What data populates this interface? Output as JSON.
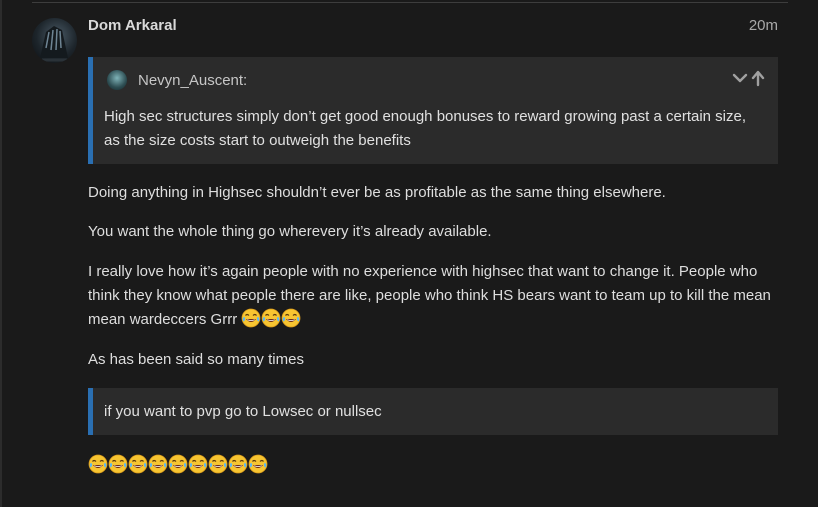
{
  "post": {
    "author": "Dom Arkaral",
    "time": "20m",
    "quote": {
      "user": "Nevyn_Auscent:",
      "text": "High sec structures simply don’t get good enough bonuses to reward growing past a certain size, as the size costs start to outweigh the benefits"
    },
    "paragraphs": [
      "Doing anything in Highsec shouldn’t ever be as profitable as the same thing elsewhere.",
      "You want the whole thing go wherevery it’s already available.",
      "I really love how it’s again people with no experience with highsec that want to change it. People who think they know what people there are like, people who think HS bears want to team up to kill the mean mean wardeccers Grrr",
      "As has been said so many times"
    ],
    "quote2": "if you want to pvp go to Lowsec or nullsec",
    "inline_emoji_count": 3,
    "emoji_row_count": 9,
    "emoji_name": "joy-icon"
  },
  "colors": {
    "background": "#1a1a1a",
    "quote_bg": "#2b2b2b",
    "quote_border": "#2a6fb2",
    "text": "#dedede"
  }
}
